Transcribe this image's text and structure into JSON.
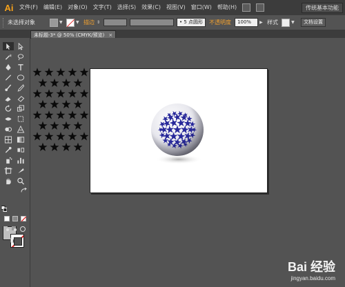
{
  "app": {
    "logo": "Ai"
  },
  "menu": {
    "items": [
      "文件(F)",
      "编辑(E)",
      "对象(O)",
      "文字(T)",
      "选择(S)",
      "效果(C)",
      "视图(V)",
      "窗口(W)",
      "帮助(H)"
    ],
    "workspace_label": "传统基本功能"
  },
  "control_bar": {
    "selection_status": "未选择对象",
    "stroke_label": "描边",
    "brush_size": "5 点圆形",
    "opacity_label": "不透明度",
    "opacity_value": "100%",
    "style_label": "样式",
    "doc_settings": "文档设置"
  },
  "document": {
    "tab_title": "未标题-3* @ 50% (CMYK/预览)",
    "close_glyph": "×"
  },
  "watermark": {
    "main": "Bai 经验",
    "sub": "jingyan.baidu.com"
  },
  "colors": {
    "accent": "#f7a21b",
    "star_blue": "#27289a",
    "artboard": "#ffffff",
    "ui_dark": "#3c3c3c",
    "ui_mid": "#535353"
  }
}
